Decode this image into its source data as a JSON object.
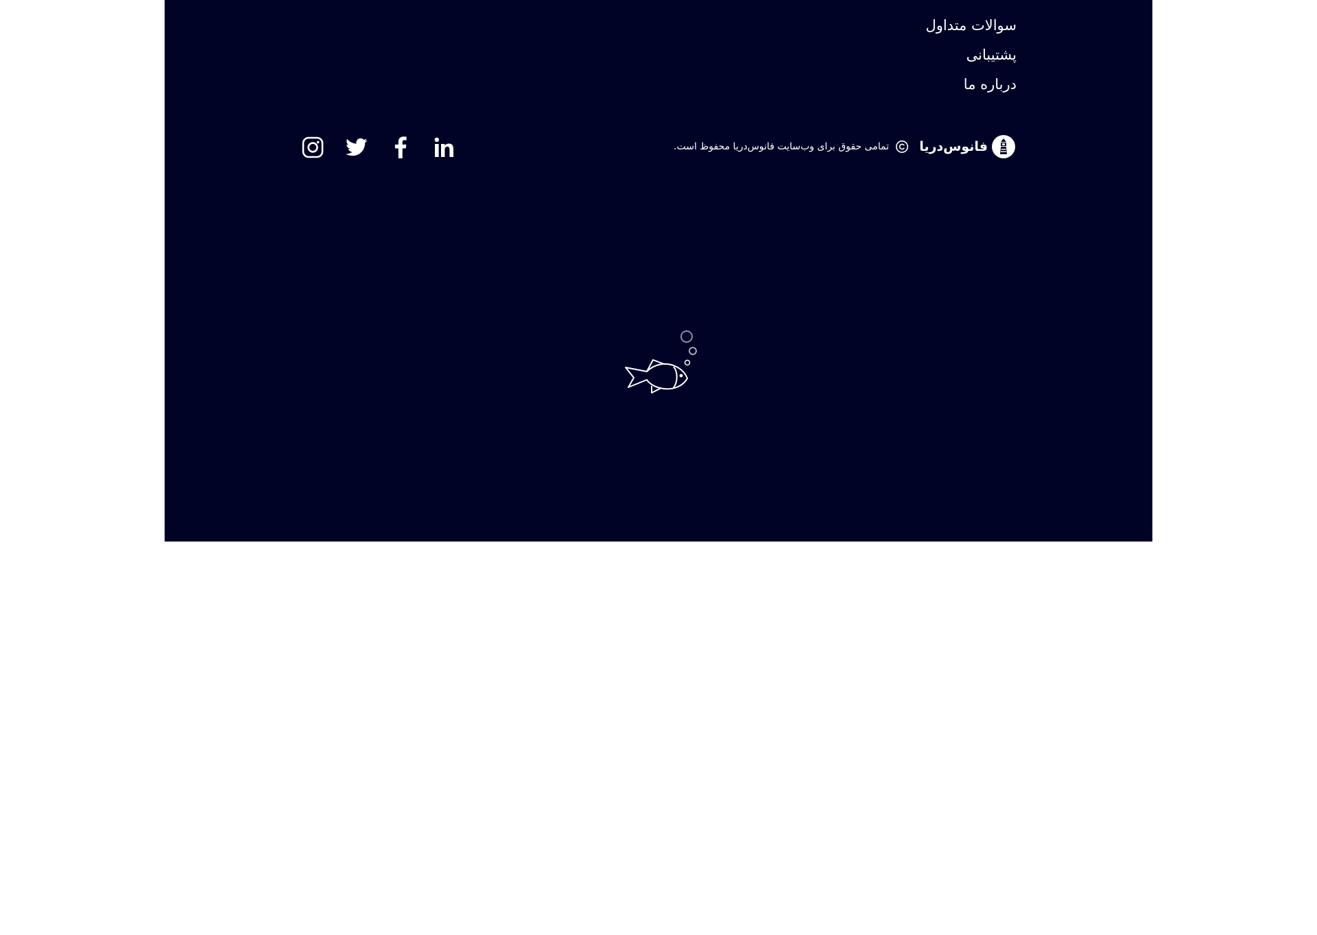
{
  "footer": {
    "links": [
      {
        "label": "سوالات متداول"
      },
      {
        "label": "پشتیبانی"
      },
      {
        "label": "درباره ما"
      }
    ],
    "brand_name": "فانوس‌دریا",
    "copyright_text": "تمامی حقوق برای وب‌سایت فانوس‌دریا محفوظ است.",
    "social_icons": [
      "instagram-icon",
      "twitter-icon",
      "facebook-icon",
      "linkedin-icon"
    ]
  },
  "loader_icon": "fish-with-bubbles-icon",
  "colors": {
    "footer_bg": "#000326",
    "text": "#ffffff",
    "page_bg": "#ffffff"
  }
}
